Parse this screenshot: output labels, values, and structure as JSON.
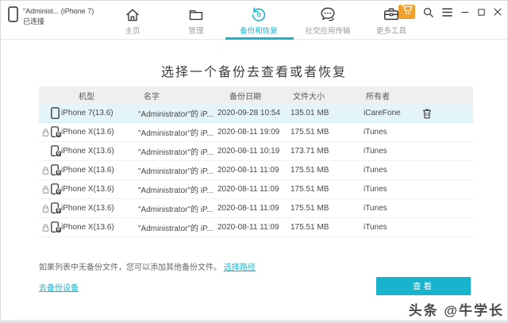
{
  "titlebar": {
    "device": {
      "name": "\"Administ... (iPhone 7)",
      "status": "已连接"
    },
    "nav": {
      "items": [
        {
          "label": "主页",
          "icon": "home-icon",
          "active": false
        },
        {
          "label": "管理",
          "icon": "folder-icon",
          "active": false
        },
        {
          "label": "备份和恢复",
          "icon": "restore-icon",
          "active": true
        },
        {
          "label": "社交应用传输",
          "icon": "chat-transfer-icon",
          "active": false
        },
        {
          "label": "更多工具",
          "icon": "toolbox-icon",
          "active": false
        }
      ]
    },
    "right_icons": [
      "cart-icon",
      "search-icon",
      "menu-icon",
      "minimize-icon",
      "maximize-icon",
      "close-icon"
    ]
  },
  "main": {
    "title": "选择一个备份去查看或者恢复",
    "table": {
      "headers": [
        "机型",
        "名字",
        "备份日期",
        "文件大小",
        "所有者"
      ],
      "rows": [
        {
          "model": "iPhone 7(13.6)",
          "name": "\"Administrator\"的 iP...",
          "date": "2020-09-28 10:54",
          "size": "135.01 MB",
          "owner": "iCareFone",
          "selected": true,
          "lock": false,
          "encrypted": false,
          "deletable": true
        },
        {
          "model": "iPhone X(13.6)",
          "name": "\"Administrator\"的 iP...",
          "date": "2020-08-11 19:09",
          "size": "175.51 MB",
          "owner": "iTunes",
          "selected": false,
          "lock": true,
          "encrypted": true,
          "deletable": false
        },
        {
          "model": "iPhone X(13.6)",
          "name": "\"Administrator\"的 iP...",
          "date": "2020-08-11 10:19",
          "size": "173.71 MB",
          "owner": "iTunes",
          "selected": false,
          "lock": false,
          "encrypted": true,
          "deletable": false
        },
        {
          "model": "iPhone X(13.6)",
          "name": "\"Administrator\"的 iP...",
          "date": "2020-08-11 11:09",
          "size": "175.51 MB",
          "owner": "iTunes",
          "selected": false,
          "lock": true,
          "encrypted": true,
          "deletable": false
        },
        {
          "model": "iPhone X(13.6)",
          "name": "\"Administrator\"的 iP...",
          "date": "2020-08-11 11:09",
          "size": "175.51 MB",
          "owner": "iTunes",
          "selected": false,
          "lock": true,
          "encrypted": true,
          "deletable": false
        },
        {
          "model": "iPhone X(13.6)",
          "name": "\"Administrator\"的 iP...",
          "date": "2020-08-11 11:09",
          "size": "175.51 MB",
          "owner": "iTunes",
          "selected": false,
          "lock": true,
          "encrypted": true,
          "deletable": false
        },
        {
          "model": "iPhone X(13.6)",
          "name": "\"Administrator\"的 iP...",
          "date": "2020-08-11 11:09",
          "size": "175.51 MB",
          "owner": "iTunes",
          "selected": false,
          "lock": true,
          "encrypted": true,
          "deletable": false
        }
      ]
    },
    "hint": {
      "text": "如果列表中无备份文件，您可以添加其他备份文件。",
      "link": "选择路径"
    },
    "backup_device_link": "去备份设备",
    "view_button": "查看"
  },
  "watermark": "头条 @牛学长",
  "colors": {
    "accent": "#1ab3ce",
    "cart_orange": "#efa12f",
    "selected_row": "#e4f5fa",
    "header_row": "#efefef"
  }
}
